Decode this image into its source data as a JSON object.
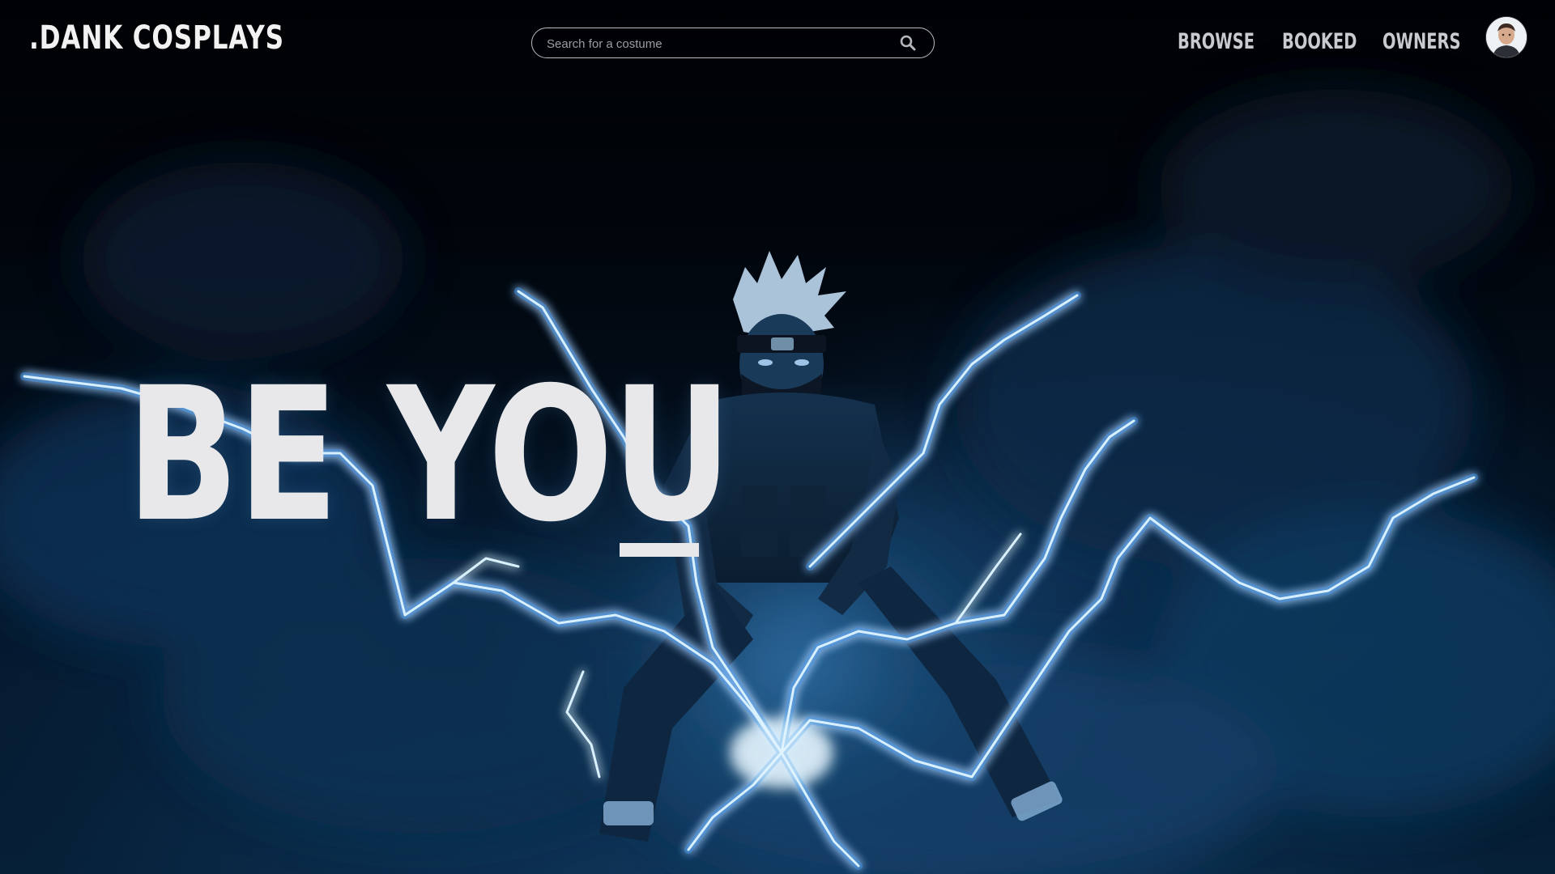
{
  "app": {
    "logo": ".DANK COSPLAYS"
  },
  "search": {
    "placeholder": "Search for a costume",
    "value": ""
  },
  "nav": {
    "browse": "BROWSE",
    "booked": "BOOKED",
    "owners": "OWNERS"
  },
  "hero": {
    "title": "BE YOU"
  },
  "icons": {
    "search": "search-icon",
    "avatar": "user-avatar"
  },
  "colors": {
    "background": "#02060c",
    "text": "#e8e8ea",
    "nav_text": "#c8cace",
    "lightning": "#bfe6ff",
    "glow": "#2f8fe0"
  }
}
